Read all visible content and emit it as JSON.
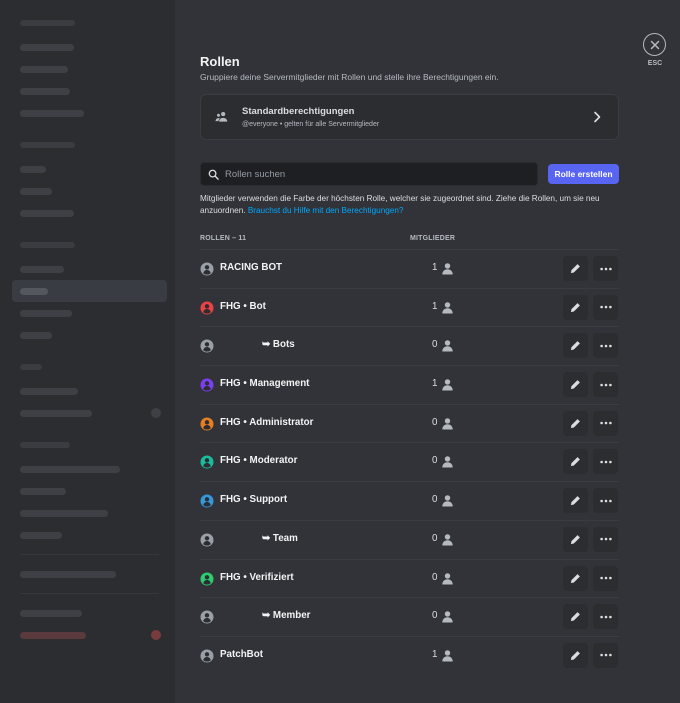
{
  "header": {
    "title": "Rollen",
    "subtitle": "Gruppiere deine Servermitglieder mit Rollen und stelle ihre Berechtigungen ein."
  },
  "default_permissions": {
    "title": "Standardberechtigungen",
    "subtitle": "@everyone • gelten für alle Servermitglieder"
  },
  "search": {
    "placeholder": "Rollen suchen"
  },
  "create_button": "Rolle erstellen",
  "info": {
    "text": "Mitglieder verwenden die Farbe der höchsten Rolle, welcher sie zugeordnet sind. Ziehe die Rollen, um sie neu anzuordnen. ",
    "link": "Brauchst du Hilfe mit den Berechtigungen?"
  },
  "table": {
    "roles_header": "ROLLEN – 11",
    "members_header": "MITGLIEDER"
  },
  "roles": [
    {
      "name": "RACING BOT",
      "count": "1",
      "color": "#9aa0a8",
      "indent": false
    },
    {
      "name": "FHG • Bot",
      "count": "1",
      "color": "#ed4245",
      "indent": false
    },
    {
      "name": "➥ Bots",
      "count": "0",
      "color": "#9aa0a8",
      "indent": true
    },
    {
      "name": "FHG • Management",
      "count": "1",
      "color": "#7b3ff2",
      "indent": false
    },
    {
      "name": "FHG • Administrator",
      "count": "0",
      "color": "#e67e22",
      "indent": false
    },
    {
      "name": "FHG • Moderator",
      "count": "0",
      "color": "#1abc9c",
      "indent": false
    },
    {
      "name": "FHG • Support",
      "count": "0",
      "color": "#3498db",
      "indent": false
    },
    {
      "name": "➥ Team",
      "count": "0",
      "color": "#9aa0a8",
      "indent": true
    },
    {
      "name": "FHG • Verifiziert",
      "count": "0",
      "color": "#2ecc71",
      "indent": false
    },
    {
      "name": "➥ Member",
      "count": "0",
      "color": "#9aa0a8",
      "indent": true
    },
    {
      "name": "PatchBot",
      "count": "1",
      "color": "#9aa0a8",
      "indent": false
    }
  ],
  "close": {
    "label": "ESC"
  },
  "icons": {
    "close": "close-icon",
    "search": "search-icon",
    "people": "people-icon",
    "chevron": "chevron-right-icon",
    "shield": "shield-icon",
    "person": "person-icon",
    "edit": "pencil-icon",
    "more": "more-icon"
  },
  "colors": {
    "accent": "#5865f2",
    "link": "#00a8fc",
    "background": "#313338",
    "sidebar": "#2b2d31"
  }
}
